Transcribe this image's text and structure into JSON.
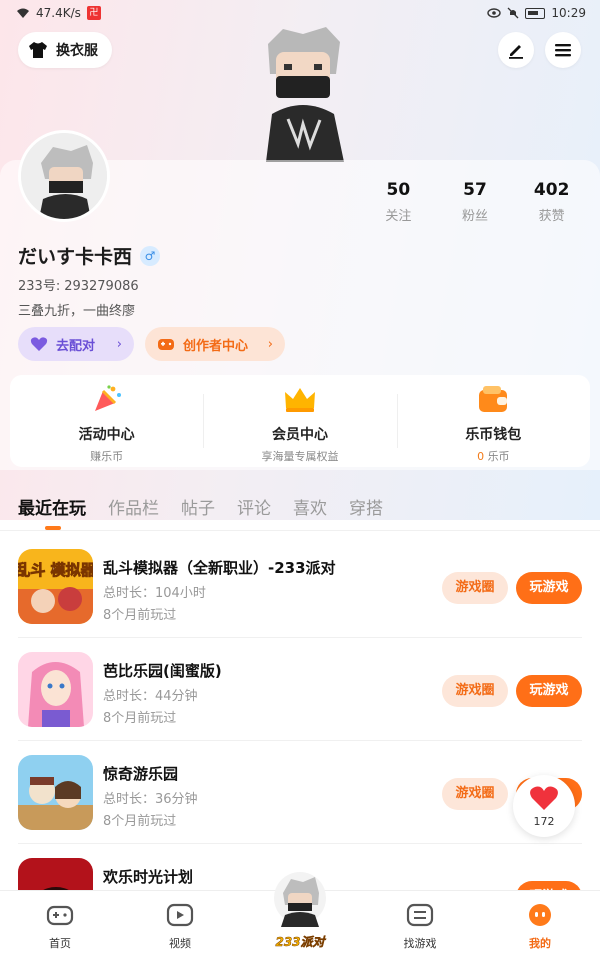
{
  "status_bar": {
    "network_speed": "47.4K/s",
    "notif_glyph": "卍",
    "time": "10:29"
  },
  "header": {
    "outfit_label": "换衣服"
  },
  "profile": {
    "stats": [
      {
        "value": "50",
        "label": "关注"
      },
      {
        "value": "57",
        "label": "粉丝"
      },
      {
        "value": "402",
        "label": "获赞"
      }
    ],
    "nickname": "だいす卡卡西",
    "gender_symbol": "♂",
    "id_label": "233号:",
    "id_value": "293279086",
    "bio": "三叠九折，一曲终廖",
    "match_label": "去配对",
    "creator_label": "创作者中心"
  },
  "features": [
    {
      "title": "活动中心",
      "sub": "赚乐币"
    },
    {
      "title": "会员中心",
      "sub": "享海量专属权益"
    },
    {
      "title": "乐币钱包",
      "coin_value": "0",
      "sub": "乐币"
    }
  ],
  "tabs": [
    "最近在玩",
    "作品栏",
    "帖子",
    "评论",
    "喜欢",
    "穿搭"
  ],
  "game_buttons": {
    "circle": "游戏圈",
    "play": "玩游戏"
  },
  "games": [
    {
      "title": "乱斗模拟器（全新职业）-233派对",
      "duration": "总时长：104小时",
      "last": "8个月前玩过",
      "icon_text": "乱斗 模拟器"
    },
    {
      "title": "芭比乐园(闺蜜版)",
      "duration": "总时长：44分钟",
      "last": "8个月前玩过"
    },
    {
      "title": "惊奇游乐园",
      "duration": "总时长：36分钟",
      "last": "8个月前玩过"
    },
    {
      "title": "欢乐时光计划"
    }
  ],
  "float_like": {
    "count": "172"
  },
  "bottom_nav": [
    {
      "label": "首页"
    },
    {
      "label": "视频"
    },
    {
      "label": "233派对"
    },
    {
      "label": "找游戏"
    },
    {
      "label": "我的"
    }
  ],
  "colors": {
    "accent": "#ff6f17",
    "purple": "#6a4fd6",
    "brand_yellow": "#f7b500"
  }
}
